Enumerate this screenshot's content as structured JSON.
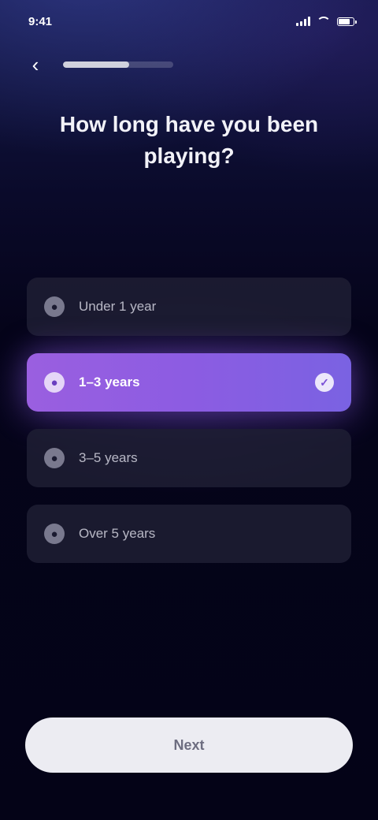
{
  "status_bar": {
    "time": "9:41"
  },
  "header": {
    "back_icon": "chevron-left-icon",
    "progress": 0.6
  },
  "title": "How long have you been playing?",
  "options": [
    {
      "label": "Under 1 year",
      "icon": "dot-icon",
      "selected": false
    },
    {
      "label": "1–3 years",
      "icon": "dot-icon",
      "selected": true
    },
    {
      "label": "3–5 years",
      "icon": "dot-icon",
      "selected": false
    },
    {
      "label": "Over 5 years",
      "icon": "dot-icon",
      "selected": false
    }
  ],
  "cta": {
    "label": "Next"
  },
  "colors": {
    "accent": "#8c5ce2",
    "background": "#05041a",
    "option_background": "#1e1e34",
    "cta_background": "#ececf2"
  }
}
